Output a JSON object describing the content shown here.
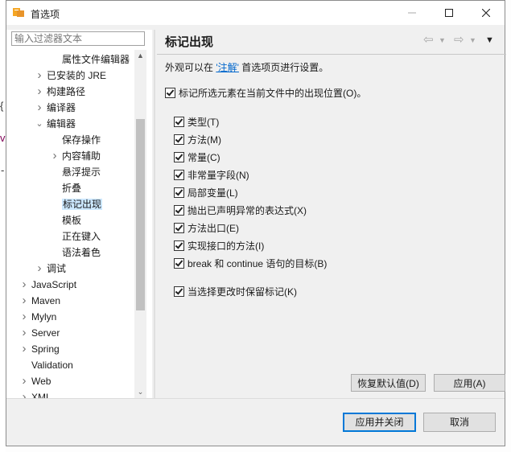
{
  "window": {
    "title": "首选项"
  },
  "filter": {
    "placeholder": "输入过滤器文本"
  },
  "tree": [
    {
      "label": "属性文件编辑器",
      "indent": 3,
      "arrow": ""
    },
    {
      "label": "已安装的 JRE",
      "indent": 2,
      "arrow": ">"
    },
    {
      "label": "构建路径",
      "indent": 2,
      "arrow": ">"
    },
    {
      "label": "编译器",
      "indent": 2,
      "arrow": ">"
    },
    {
      "label": "编辑器",
      "indent": 2,
      "arrow": "v"
    },
    {
      "label": "保存操作",
      "indent": 3,
      "arrow": ""
    },
    {
      "label": "内容辅助",
      "indent": 3,
      "arrow": ">"
    },
    {
      "label": "悬浮提示",
      "indent": 3,
      "arrow": ""
    },
    {
      "label": "折叠",
      "indent": 3,
      "arrow": ""
    },
    {
      "label": "标记出现",
      "indent": 3,
      "arrow": "",
      "selected": true
    },
    {
      "label": "模板",
      "indent": 3,
      "arrow": ""
    },
    {
      "label": "正在键入",
      "indent": 3,
      "arrow": ""
    },
    {
      "label": "语法着色",
      "indent": 3,
      "arrow": ""
    },
    {
      "label": "调试",
      "indent": 2,
      "arrow": ">"
    },
    {
      "label": "JavaScript",
      "indent": 1,
      "arrow": ">"
    },
    {
      "label": "Maven",
      "indent": 1,
      "arrow": ">"
    },
    {
      "label": "Mylyn",
      "indent": 1,
      "arrow": ">"
    },
    {
      "label": "Server",
      "indent": 1,
      "arrow": ">"
    },
    {
      "label": "Spring",
      "indent": 1,
      "arrow": ">"
    },
    {
      "label": "Validation",
      "indent": 1,
      "arrow": ""
    },
    {
      "label": "Web",
      "indent": 1,
      "arrow": ">"
    },
    {
      "label": "XML",
      "indent": 1,
      "arrow": ">"
    }
  ],
  "page": {
    "title": "标记出现",
    "desc_prefix": "外观可以在",
    "desc_link": "'注解'",
    "desc_suffix": "首选项页进行设置。",
    "main_checkbox": "标记所选元素在当前文件中的出现位置(O)。",
    "options": [
      "类型(T)",
      "方法(M)",
      "常量(C)",
      "非常量字段(N)",
      "局部变量(L)",
      "抛出已声明异常的表达式(X)",
      "方法出口(E)",
      "实现接口的方法(I)",
      "break 和 continue 语句的目标(B)"
    ],
    "keep_checkbox": "当选择更改时保留标记(K)",
    "restore_button": "恢复默认值(D)",
    "apply_button": "应用(A)"
  },
  "footer": {
    "apply_close": "应用并关闭",
    "cancel": "取消"
  },
  "edge_glyphs": [
    "{",
    "v",
    "-"
  ]
}
